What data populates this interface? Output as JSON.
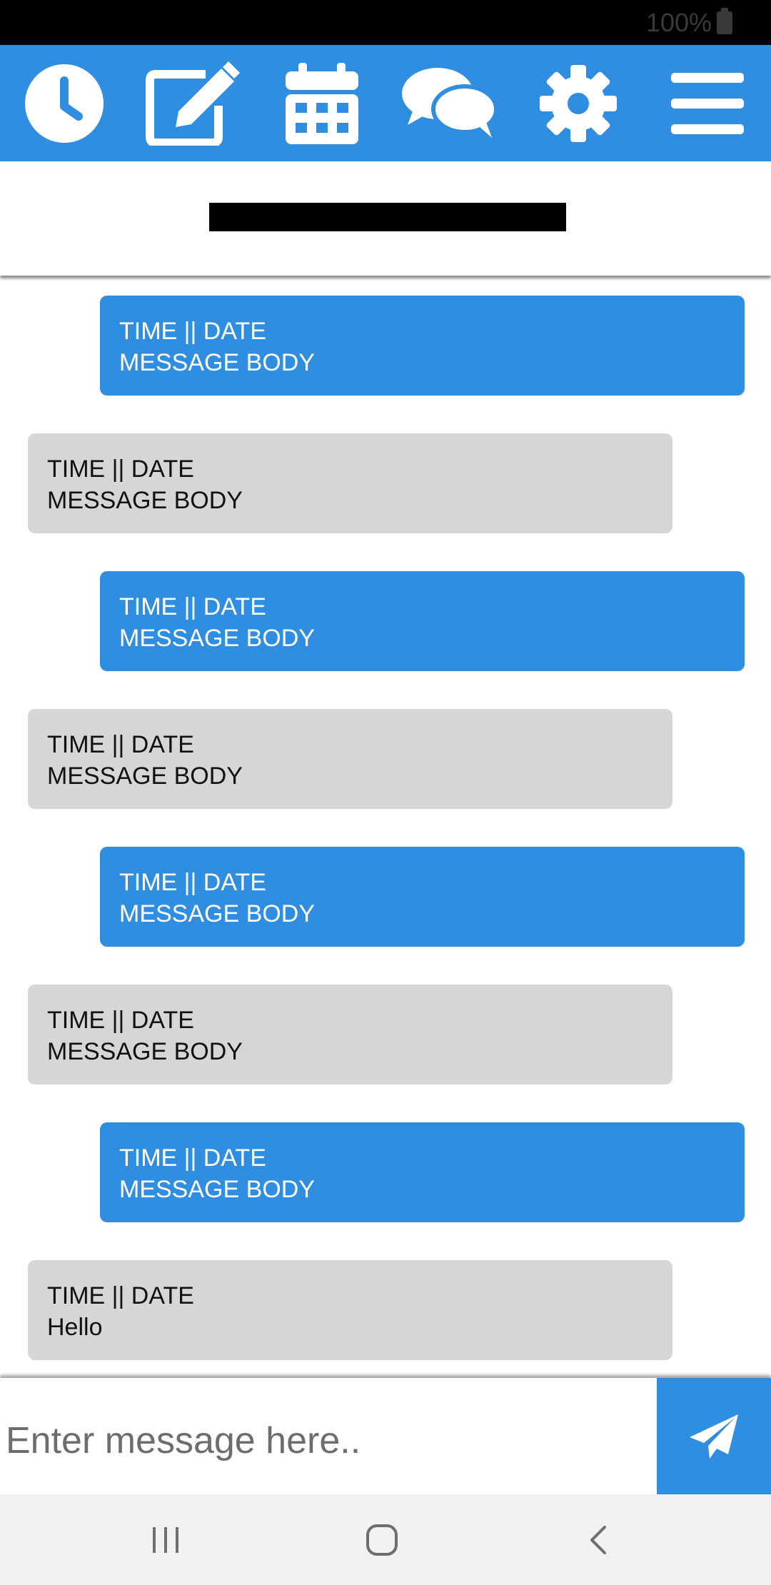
{
  "status_bar": {
    "battery_text": "100%",
    "battery_icon": "battery-full-icon"
  },
  "toolbar": {
    "items": [
      {
        "name": "clock",
        "icon": "clock-icon"
      },
      {
        "name": "compose",
        "icon": "edit-icon"
      },
      {
        "name": "calendar",
        "icon": "calendar-icon"
      },
      {
        "name": "chat",
        "icon": "chat-bubbles-icon"
      },
      {
        "name": "settings",
        "icon": "gear-icon"
      },
      {
        "name": "menu",
        "icon": "hamburger-menu-icon"
      }
    ]
  },
  "header": {
    "title": ""
  },
  "messages": [
    {
      "direction": "sent",
      "meta": "TIME || DATE",
      "body": "MESSAGE BODY"
    },
    {
      "direction": "received",
      "meta": "TIME || DATE",
      "body": "MESSAGE BODY"
    },
    {
      "direction": "sent",
      "meta": "TIME || DATE",
      "body": "MESSAGE BODY"
    },
    {
      "direction": "received",
      "meta": "TIME || DATE",
      "body": "MESSAGE BODY"
    },
    {
      "direction": "sent",
      "meta": "TIME || DATE",
      "body": "MESSAGE BODY"
    },
    {
      "direction": "received",
      "meta": "TIME || DATE",
      "body": "MESSAGE BODY"
    },
    {
      "direction": "sent",
      "meta": "TIME || DATE",
      "body": "MESSAGE BODY"
    },
    {
      "direction": "received",
      "meta": "TIME || DATE",
      "body": "Hello"
    }
  ],
  "composer": {
    "placeholder": "Enter message here..",
    "value": "",
    "send_icon": "paper-plane-icon"
  },
  "nav_bar": {
    "recents_icon": "recent-apps-icon",
    "home_icon": "home-icon",
    "back_icon": "back-icon"
  },
  "colors": {
    "accent": "#2f8ee0",
    "received_bubble": "#d6d6d6",
    "status_bar": "#000000",
    "nav_bar": "#f1f1f1"
  }
}
